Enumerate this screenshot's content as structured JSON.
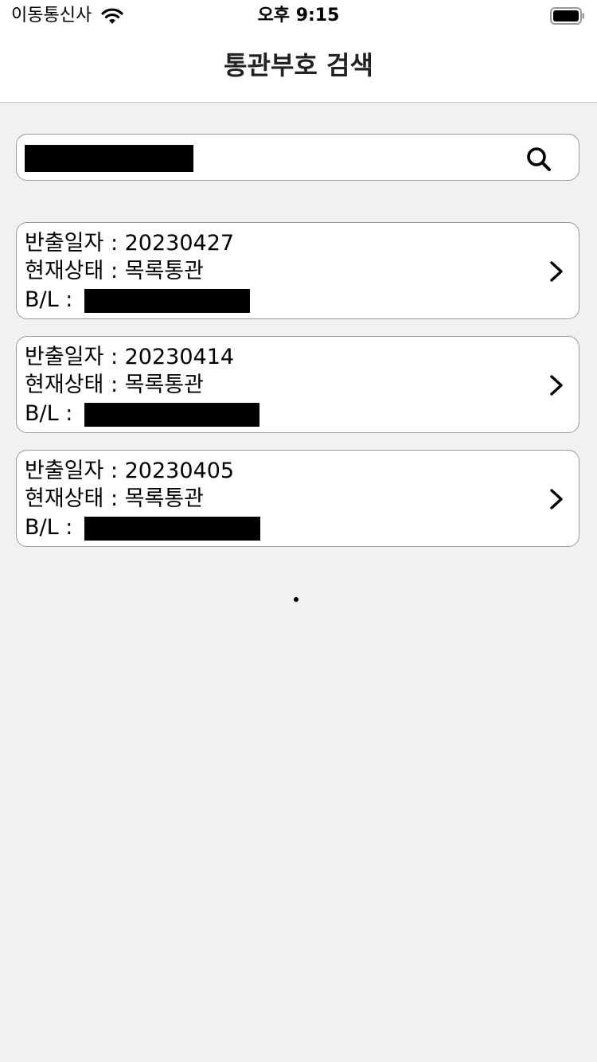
{
  "status_bar": {
    "carrier": "이동통신사",
    "time": "오후 9:15",
    "wifi_icon": "wifi-icon",
    "battery_icon": "battery-icon"
  },
  "nav": {
    "title": "통관부호 검색"
  },
  "search": {
    "value": "",
    "icon": "search-icon"
  },
  "results": [
    {
      "date_label": "반출일자 : ",
      "date": "20230427",
      "status_label": "현재상태 : ",
      "status": "목록통관",
      "bl_label": "B/L : ",
      "bl": "",
      "chevron_icon": "chevron-right-icon"
    },
    {
      "date_label": "반출일자 : ",
      "date": "20230414",
      "status_label": "현재상태 : ",
      "status": "목록통관",
      "bl_label": "B/L : ",
      "bl": "",
      "chevron_icon": "chevron-right-icon"
    },
    {
      "date_label": "반출일자 : ",
      "date": "20230405",
      "status_label": "현재상태 : ",
      "status": "목록통관",
      "bl_label": "B/L : ",
      "bl": "",
      "chevron_icon": "chevron-right-icon"
    }
  ]
}
